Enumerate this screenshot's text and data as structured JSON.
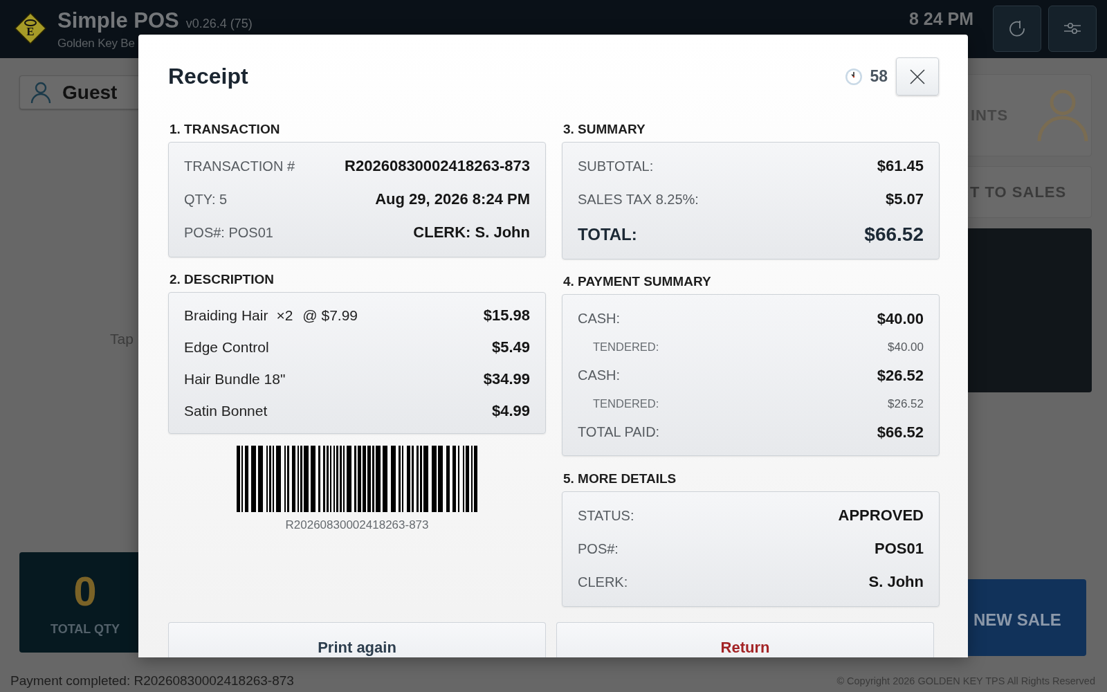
{
  "header": {
    "logo_letter": "E",
    "title": "Simple POS",
    "version": "v0.26.4 (75)",
    "subtitle": "Golden Key Be",
    "time": "8 24 PM"
  },
  "left_panel": {
    "customer": "Guest",
    "hint": "Tap",
    "total_qty": {
      "value": "0",
      "label": "TOTAL QTY"
    }
  },
  "right_panel": {
    "points_button": "INTS",
    "sales_button": "T TO SALES",
    "new_sale_button": "NEW SALE"
  },
  "receipt": {
    "title": "Receipt",
    "countdown": "58",
    "transaction": {
      "heading": "1. TRANSACTION",
      "rows": [
        {
          "left": "TRANSACTION #",
          "right": "R20260830002418263-873"
        },
        {
          "left": "QTY: 5",
          "right": "Aug 29, 2026 8:24 PM"
        },
        {
          "left": "POS#: POS01",
          "right": "CLERK: S. John"
        }
      ]
    },
    "description": {
      "heading": "2. DESCRIPTION",
      "items": [
        {
          "name": "Braiding Hair",
          "qty": "×2",
          "unit_price": "@ $7.99",
          "amount": "$15.98"
        },
        {
          "name": "Edge Control",
          "amount": "$5.49"
        },
        {
          "name": "Hair Bundle 18\"",
          "amount": "$34.99"
        },
        {
          "name": "Satin Bonnet",
          "amount": "$4.99"
        }
      ]
    },
    "barcode": {
      "text": "R20260830002418263-873"
    },
    "summary": {
      "heading": "3. SUMMARY",
      "rows": [
        {
          "kind": "line",
          "label": "SUBTOTAL:",
          "value": "$61.45"
        },
        {
          "kind": "line",
          "label": "SALES TAX 8.25%:",
          "value": "$5.07"
        },
        {
          "kind": "total",
          "label": "TOTAL:",
          "value": "$66.52"
        }
      ]
    },
    "payment_summary": {
      "heading": "4. PAYMENT SUMMARY",
      "rows": [
        {
          "kind": "main",
          "label": "CASH:",
          "value": "$40.00"
        },
        {
          "kind": "sub",
          "label": "TENDERED:",
          "value": "$40.00"
        },
        {
          "kind": "main",
          "label": "CASH:",
          "value": "$26.52"
        },
        {
          "kind": "sub",
          "label": "TENDERED:",
          "value": "$26.52"
        },
        {
          "kind": "main",
          "label": "TOTAL PAID:",
          "value": "$66.52"
        }
      ]
    },
    "more_details": {
      "heading": "5. MORE DETAILS",
      "rows": [
        {
          "label": "STATUS:",
          "value": "APPROVED"
        },
        {
          "label": "POS#:",
          "value": "POS01"
        },
        {
          "label": "CLERK:",
          "value": "S. John"
        }
      ]
    },
    "buttons": [
      {
        "kind": "neutral",
        "label": "Print again"
      },
      {
        "kind": "danger",
        "label": "Return"
      }
    ]
  },
  "status_bar": {
    "message": "Payment completed: R20260830002418263-873",
    "copyright": "© Copyright 2026 GOLDEN KEY TPS All Rights Reserved"
  }
}
